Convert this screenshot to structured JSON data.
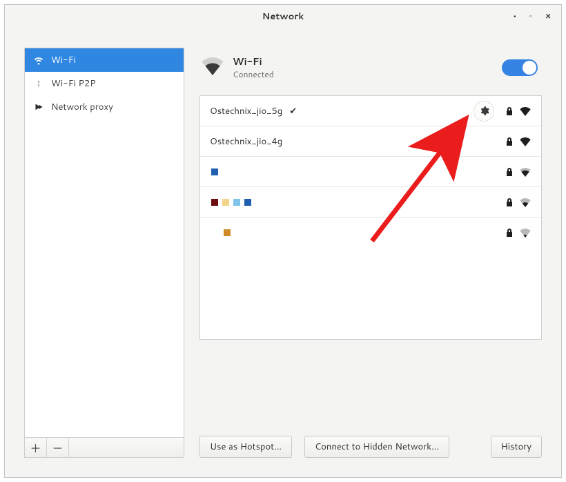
{
  "window": {
    "title": "Network"
  },
  "sidebar": {
    "items": [
      {
        "label": "Wi-Fi",
        "icon": "wifi"
      },
      {
        "label": "Wi-Fi P2P",
        "icon": "wifi-p2p"
      },
      {
        "label": "Network proxy",
        "icon": "proxy"
      }
    ]
  },
  "panel": {
    "title": "Wi-Fi",
    "status": "Connected",
    "toggle_on": true
  },
  "networks": [
    {
      "name": "Ostechnix_jio_5g",
      "connected": true,
      "secured": true,
      "strength": 4,
      "gear": true
    },
    {
      "name": "Ostechnix_jio_4g",
      "connected": false,
      "secured": true,
      "strength": 4
    },
    {
      "name": "",
      "swatches": [
        "#1f5fb0"
      ],
      "secured": true,
      "strength": 3
    },
    {
      "name": "",
      "swatches": [
        "#6b0f11",
        "#f3d48b",
        "#7fc3e8",
        "#1f5fb0"
      ],
      "secured": true,
      "strength": 2
    },
    {
      "name": "",
      "swatches": [
        "#d08a28"
      ],
      "indent": true,
      "secured": true,
      "strength": 1
    }
  ],
  "buttons": {
    "hotspot": "Use as Hotspot...",
    "hidden": "Connect to Hidden Network...",
    "history": "History"
  }
}
